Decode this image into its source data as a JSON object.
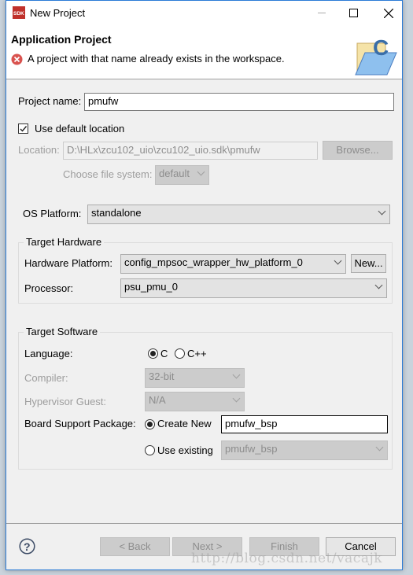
{
  "window": {
    "title": "New Project",
    "app_icon": "sdk-icon",
    "controls": [
      "minimize-icon",
      "maximize-icon",
      "close-icon"
    ]
  },
  "header": {
    "title": "Application Project",
    "message": "A project with that name already exists in the workspace.",
    "message_icon": "error-icon",
    "banner_icon": "c-folder-icon"
  },
  "project": {
    "name_label": "Project name:",
    "name_value": "pmufw",
    "use_default_label": "Use default location",
    "use_default_checked": true,
    "location_label": "Location:",
    "location_value": "D:\\HLx\\zcu102_uio\\zcu102_uio.sdk\\pmufw",
    "browse_label": "Browse...",
    "filesystem_label": "Choose file system:",
    "filesystem_value": "default"
  },
  "os": {
    "label": "OS Platform:",
    "value": "standalone"
  },
  "hardware": {
    "legend": "Target Hardware",
    "platform_label": "Hardware Platform:",
    "platform_value": "config_mpsoc_wrapper_hw_platform_0",
    "new_label": "New...",
    "processor_label": "Processor:",
    "processor_value": "psu_pmu_0"
  },
  "software": {
    "legend": "Target Software",
    "language_label": "Language:",
    "lang_c": "C",
    "lang_cpp": "C++",
    "selected_language": "C",
    "compiler_label": "Compiler:",
    "compiler_value": "32-bit",
    "hypervisor_label": "Hypervisor Guest:",
    "hypervisor_value": "N/A",
    "bsp_label": "Board Support Package:",
    "create_new_label": "Create New",
    "create_new_value": "pmufw_bsp",
    "use_existing_label": "Use existing",
    "use_existing_value": "pmufw_bsp",
    "bsp_choice": "Create New"
  },
  "footer": {
    "back": "< Back",
    "next": "Next >",
    "finish": "Finish",
    "cancel": "Cancel",
    "help_icon": "help-icon"
  },
  "watermark": "http://blog.csdn.net/vacajk"
}
